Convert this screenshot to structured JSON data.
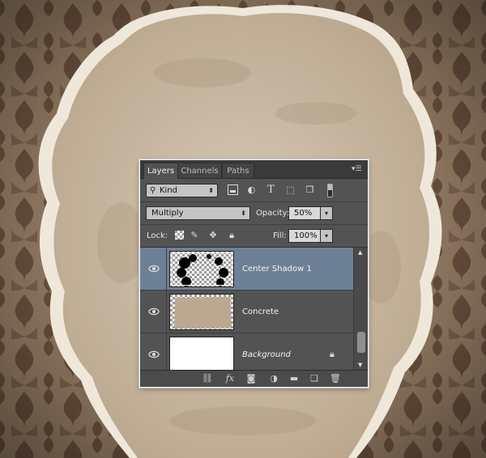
{
  "panel": {
    "tabs": [
      {
        "label": "Layers",
        "active": true
      },
      {
        "label": "Channels",
        "active": false
      },
      {
        "label": "Paths",
        "active": false
      }
    ],
    "menu_icon": "panel-menu-icon"
  },
  "filter": {
    "kind_label": "Kind",
    "icons": [
      "image-filter-icon",
      "adjustment-filter-icon",
      "type-filter-icon",
      "shape-filter-icon",
      "smart-object-filter-icon"
    ],
    "type_glyph": "T"
  },
  "blend": {
    "mode": "Multiply",
    "opacity_label": "Opacity:",
    "opacity_value": "50%"
  },
  "lock": {
    "label": "Lock:",
    "fill_label": "Fill:",
    "fill_value": "100%"
  },
  "layers": [
    {
      "name": "Center Shadow 1",
      "selected": true,
      "visible": true,
      "locked": false
    },
    {
      "name": "Concrete",
      "selected": false,
      "visible": true,
      "locked": false
    },
    {
      "name": "Background",
      "selected": false,
      "visible": true,
      "locked": true
    }
  ],
  "footer": {
    "fx_label": "fx"
  },
  "colors": {
    "panel": "#535353",
    "selection": "#6e8096",
    "wallpaper": "#7a624b",
    "concrete": "#c9b9a3"
  }
}
